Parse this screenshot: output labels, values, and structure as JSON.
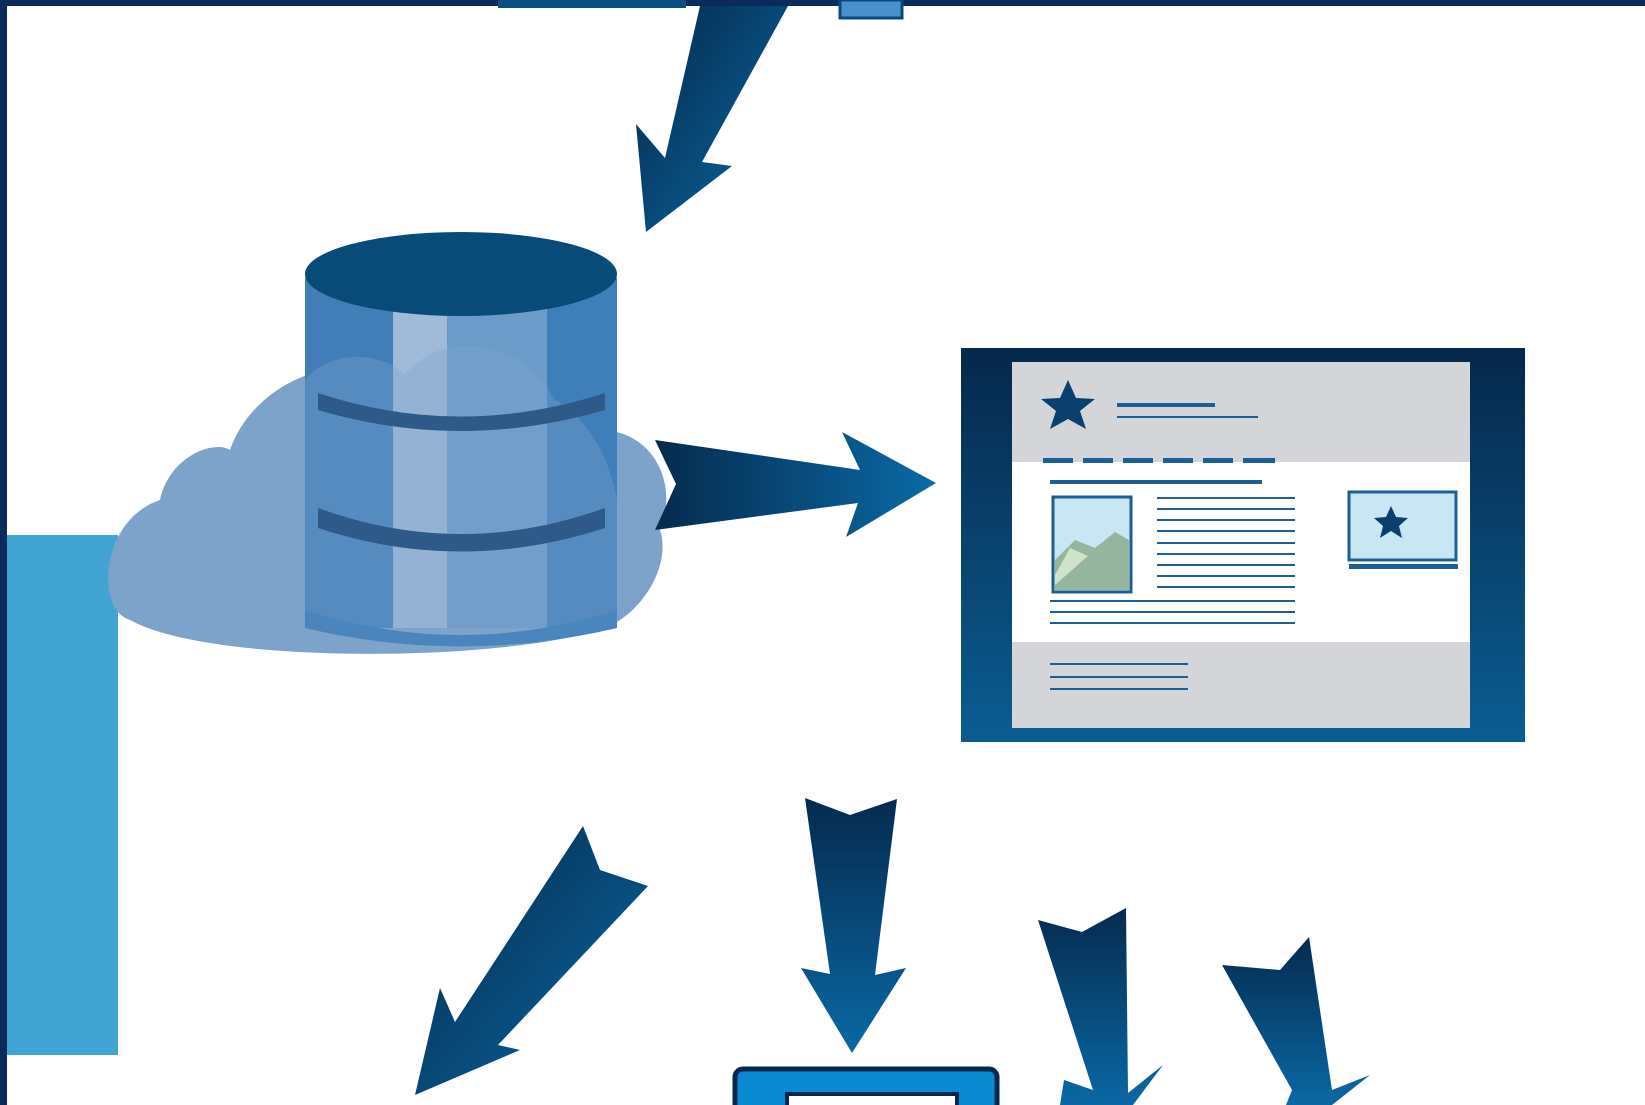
{
  "diagram": {
    "nodes": [
      {
        "id": "cloud-database",
        "icon": "cloud-database-icon"
      },
      {
        "id": "web-page",
        "icon": "web-page-icon"
      },
      {
        "id": "laptop",
        "icon": "laptop-icon"
      }
    ],
    "edges": [
      {
        "from": "top-source",
        "to": "cloud-database"
      },
      {
        "from": "cloud-database",
        "to": "web-page"
      },
      {
        "from": "web-page",
        "to": "bottom-left-target"
      },
      {
        "from": "web-page",
        "to": "laptop"
      },
      {
        "from": "web-page",
        "to": "bottom-right-target-1"
      },
      {
        "from": "web-page",
        "to": "bottom-right-target-2"
      }
    ]
  },
  "colors": {
    "frame": "#0b2a5c",
    "arrow_dark": "#062f55",
    "arrow_light": "#0a5f96",
    "cylinder_top": "#084a78",
    "cylinder_mid": "#4a86bd",
    "cloud": "#7ea3cb",
    "accent_bar": "#42a4d2",
    "web_frame": "#0a4a7a",
    "web_panel_grey": "#d3d5d8"
  }
}
